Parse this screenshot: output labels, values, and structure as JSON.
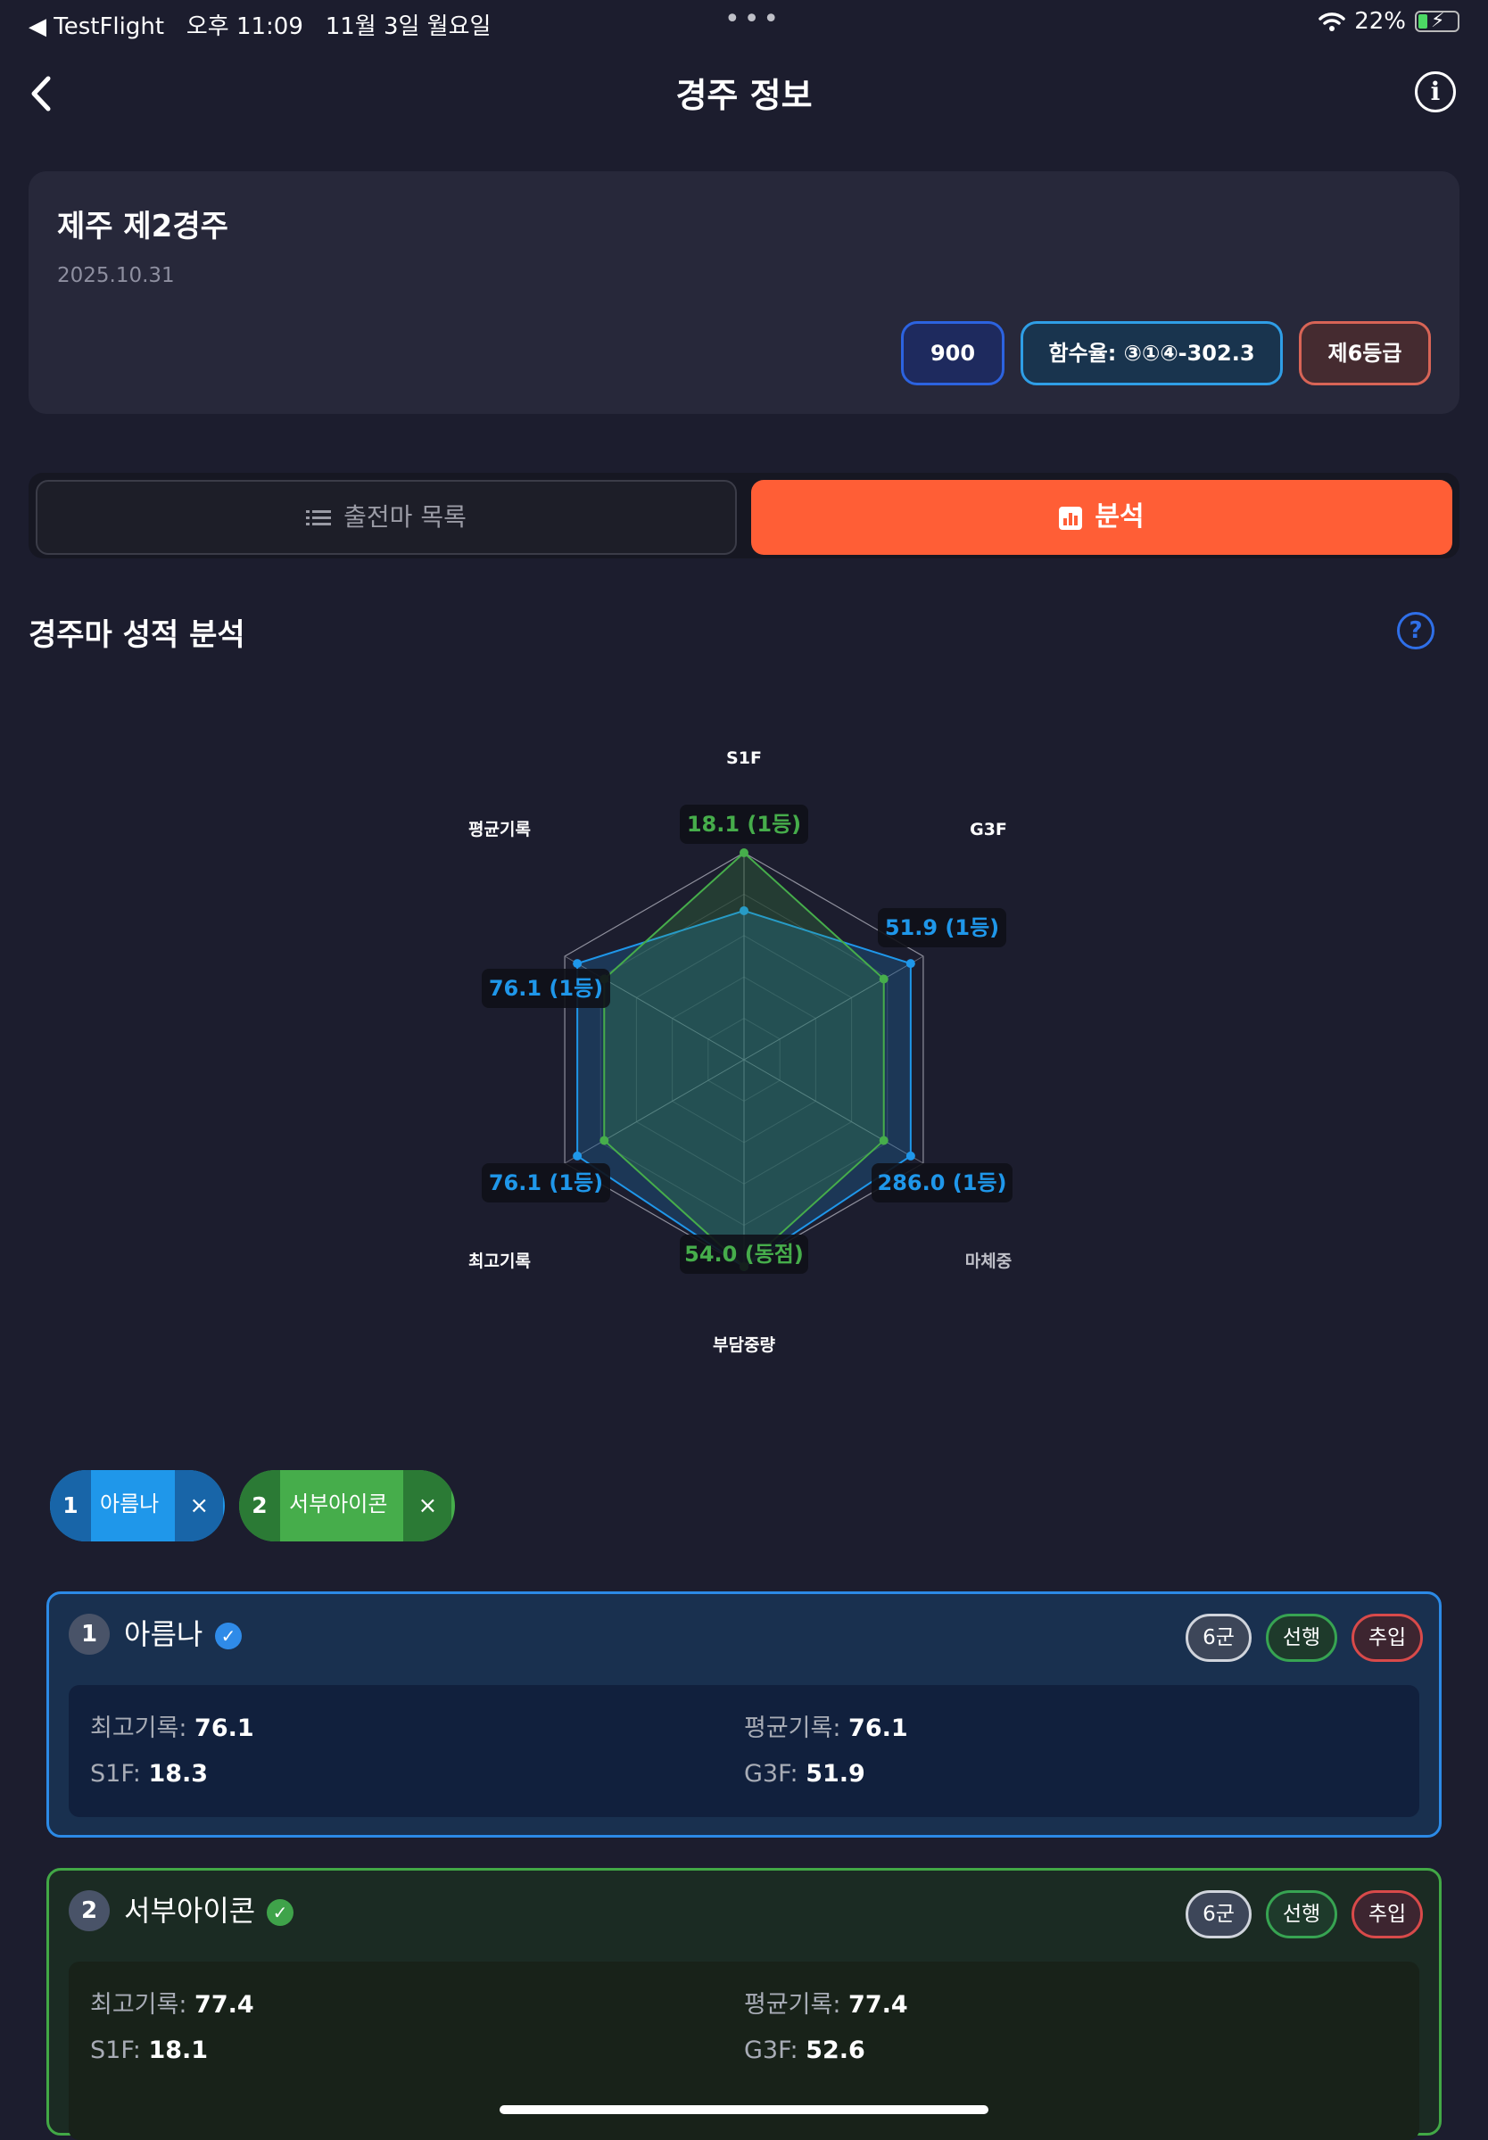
{
  "status_bar": {
    "app": "◀ TestFlight",
    "time": "오후 11:09",
    "date": "11월 3일 월요일",
    "battery": "22%"
  },
  "nav": {
    "title": "경주 정보"
  },
  "race": {
    "title": "제주 제2경주",
    "date": "2025.10.31",
    "distance": "900",
    "moisture": "함수율: ③①④-302.3",
    "grade": "제6등급"
  },
  "tabs": {
    "entries": "출전마 목록",
    "analysis": "분석"
  },
  "section": {
    "title": "경주마 성적 분석"
  },
  "colors": {
    "horse1": "#1f97ea",
    "horse2": "#46ad4b",
    "accent": "#ff5e36"
  },
  "chart_data": {
    "type": "radar",
    "axes": [
      "S1F",
      "G3F",
      "마체중",
      "부담중량",
      "최고기록",
      "평균기록"
    ],
    "series": [
      {
        "name": "아름나",
        "values": [
          0.72,
          0.93,
          0.93,
          1.0,
          0.93,
          0.93
        ]
      },
      {
        "name": "서부아이콘",
        "values": [
          1.0,
          0.78,
          0.78,
          1.0,
          0.78,
          0.78
        ]
      }
    ],
    "labels": [
      {
        "text": "18.1 (1등)",
        "series": 1,
        "axis": 0
      },
      {
        "text": "51.9 (1등)",
        "series": 0,
        "axis": 1
      },
      {
        "text": "286.0 (1등)",
        "series": 0,
        "axis": 2
      },
      {
        "text": "54.0 (동점)",
        "series": 1,
        "axis": 3
      },
      {
        "text": "76.1 (1등)",
        "series": 0,
        "axis": 4
      },
      {
        "text": "76.1 (1등)",
        "series": 0,
        "axis": 5
      }
    ]
  },
  "selected_horses": [
    {
      "num": "1",
      "name": "아름나",
      "remove": "×"
    },
    {
      "num": "2",
      "name": "서부아이콘",
      "remove": "×"
    }
  ],
  "horses": [
    {
      "num": "1",
      "name": "아름나",
      "group": "6군",
      "style": "선행",
      "position": "추입",
      "best_label": "최고기록: ",
      "best": "76.1",
      "avg_label": "평균기록: ",
      "avg": "76.1",
      "s1f_label": "S1F: ",
      "s1f": "18.3",
      "g3f_label": "G3F: ",
      "g3f": "51.9"
    },
    {
      "num": "2",
      "name": "서부아이콘",
      "group": "6군",
      "style": "선행",
      "position": "추입",
      "best_label": "최고기록: ",
      "best": "77.4",
      "avg_label": "평균기록: ",
      "avg": "77.4",
      "s1f_label": "S1F: ",
      "s1f": "18.1",
      "g3f_label": "G3F: ",
      "g3f": "52.6"
    }
  ]
}
